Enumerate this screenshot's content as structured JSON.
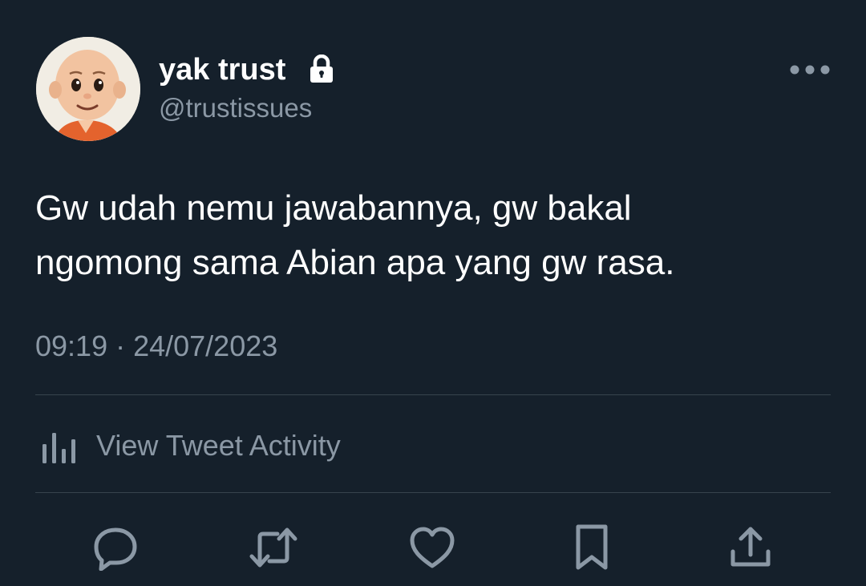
{
  "author": {
    "display_name": "yak trust",
    "handle": "@trustissues",
    "avatar_icon": "cartoon-avatar",
    "protected_icon": "lock-icon"
  },
  "tweet": {
    "text_lines": [
      "Gw udah nemu jawabannya, gw bakal",
      "ngomong sama Abian apa yang gw rasa."
    ],
    "timestamp": "09:19 · 24/07/2023"
  },
  "activity": {
    "label": "View Tweet Activity",
    "icon": "bar-chart-icon"
  },
  "actions": [
    {
      "name": "reply",
      "icon": "reply-icon"
    },
    {
      "name": "retweet",
      "icon": "retweet-icon"
    },
    {
      "name": "like",
      "icon": "heart-icon"
    },
    {
      "name": "bookmark",
      "icon": "bookmark-icon"
    },
    {
      "name": "share",
      "icon": "share-icon"
    }
  ],
  "colors": {
    "background": "#15202b",
    "primary_text": "#ffffff",
    "secondary_text": "#8b98a5",
    "divider": "#38444d"
  }
}
